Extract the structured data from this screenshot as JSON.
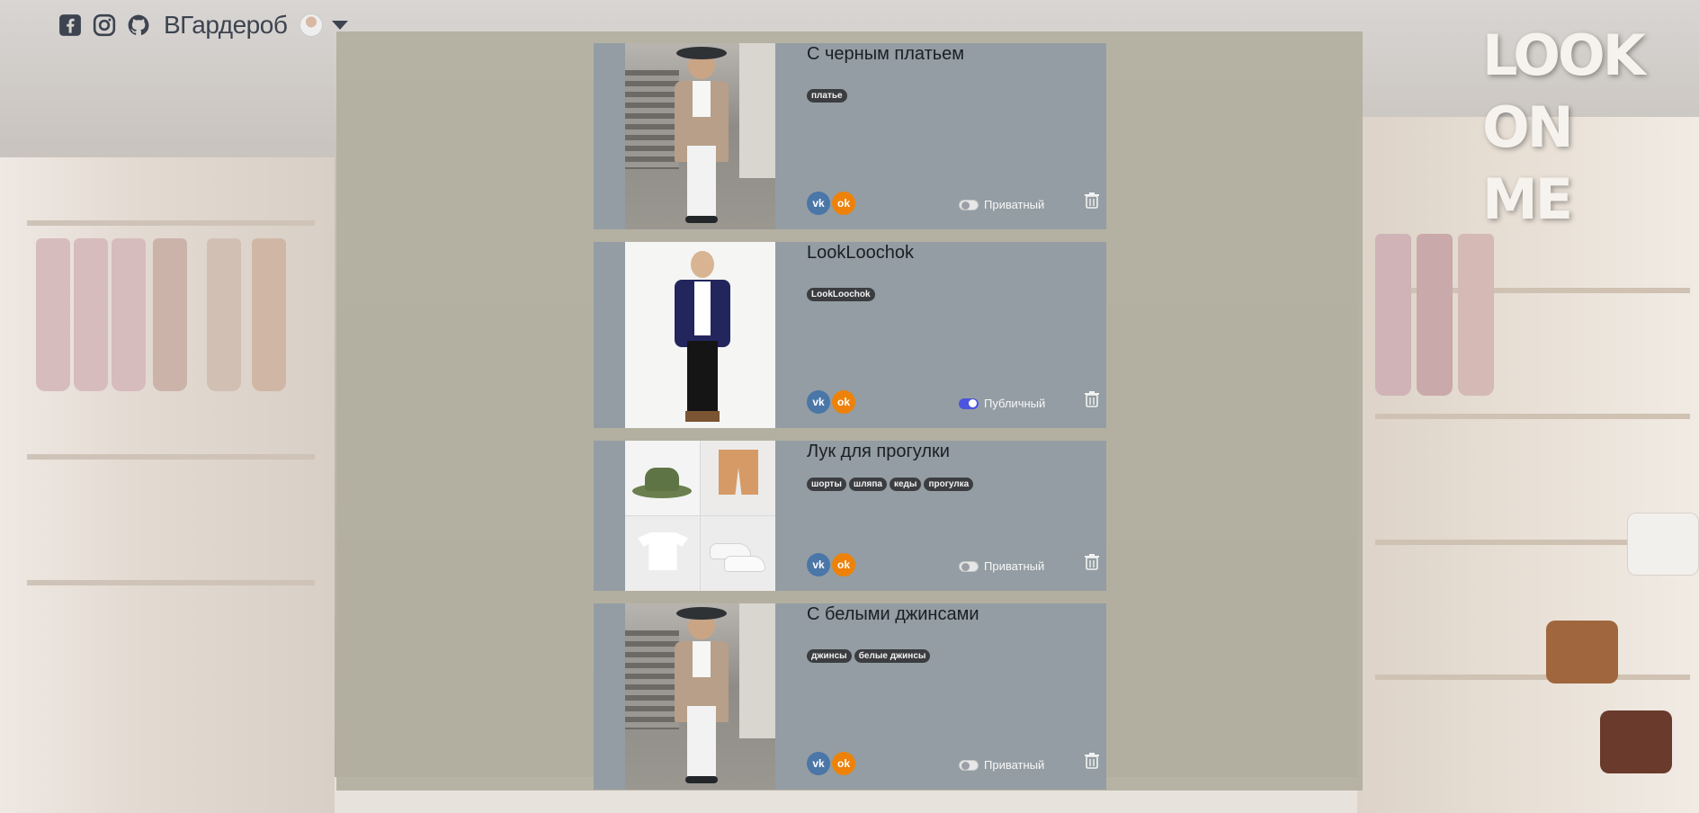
{
  "app": {
    "brand": "ВГардероб",
    "logo_lines": [
      "LOOK",
      "ON",
      "ME"
    ]
  },
  "header": {
    "social_icons": [
      "facebook-icon",
      "instagram-icon",
      "github-icon"
    ],
    "user_menu_icon": "chevron-down-icon"
  },
  "colors": {
    "card_bg": "#939da3",
    "tag_bg": "#3b3d40",
    "vk": "#4a76a8",
    "ok": "#ee8208",
    "toggle_on": "#4b55e0"
  },
  "looks": [
    {
      "title": "С черным платьем",
      "tags": [
        "платье"
      ],
      "privacy": "Приватный",
      "is_public": false,
      "share": [
        "vk",
        "ok"
      ]
    },
    {
      "title": "LookLoochok",
      "tags": [
        "LookLoochok"
      ],
      "privacy": "Публичный",
      "is_public": true,
      "share": [
        "vk",
        "ok"
      ]
    },
    {
      "title": "Лук для прогулки",
      "tags": [
        "шорты",
        "шляпа",
        "кеды",
        "прогулка"
      ],
      "privacy": "Приватный",
      "is_public": false,
      "share": [
        "vk",
        "ok"
      ]
    },
    {
      "title": "С белыми джинсами",
      "tags": [
        "джинсы",
        "белые джинсы"
      ],
      "privacy": "Приватный",
      "is_public": false,
      "share": [
        "vk",
        "ok"
      ]
    }
  ]
}
